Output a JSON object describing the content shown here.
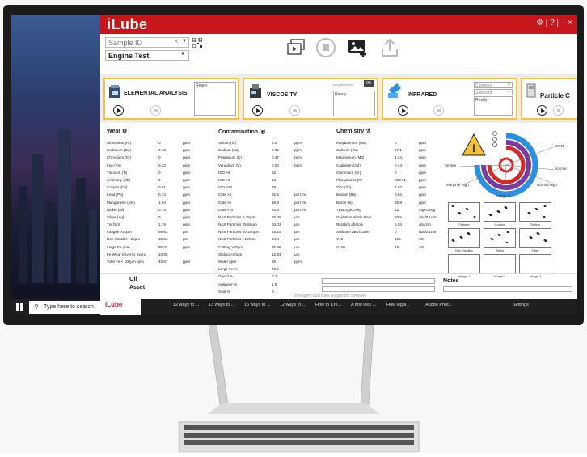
{
  "app": {
    "logo": "iLube",
    "footer": "Intelligent Lubricant Diagnostic Software"
  },
  "window_controls": {
    "help": "?",
    "minimize": "–",
    "close": "×"
  },
  "toolbar": {
    "sample_id_placeholder": "Sample ID",
    "sample_clear": "×",
    "engine_test": "Engine Test"
  },
  "modules": {
    "elemental": {
      "title": "ELEMENTAL ANALYSIS",
      "status": "Ready"
    },
    "viscosity": {
      "title": "VISCOSITY",
      "status": "Ready",
      "counter_label": "sample count",
      "counter": "00"
    },
    "infrared": {
      "title": "INFRARED",
      "select1": "Category",
      "select2": "Standard",
      "status": "Ready"
    },
    "particle": {
      "title": "Particle C"
    }
  },
  "wear": {
    "title": "Wear",
    "rows": [
      [
        "Aluminium (Al)",
        "0",
        "ppm"
      ],
      [
        "Cadmium (Cd)",
        "0.43",
        "ppm"
      ],
      [
        "Chromium (Cr)",
        "0",
        "ppm"
      ],
      [
        "Iron (Fe)",
        "0.22",
        "ppm"
      ],
      [
        "Titanium (Ti)",
        "0",
        "ppm"
      ],
      [
        "Antimony (Sb)",
        "0",
        "ppm"
      ],
      [
        "Copper (Cu)",
        "0.01",
        "ppm"
      ],
      [
        "Lead (Pb)",
        "0.74",
        "ppm"
      ],
      [
        "Manganese (Mn)",
        "1.84",
        "ppm"
      ],
      [
        "Nickel (Ni)",
        "0.75",
        "ppm"
      ],
      [
        "Silver (Ag)",
        "0",
        "ppm"
      ],
      [
        "Tin (Sn)",
        "1.79",
        "ppm"
      ],
      [
        "Fatigue >20μm",
        "56.63",
        "μm"
      ],
      [
        "Non-Metallic >20μm",
        "12.53",
        "μm"
      ],
      [
        "Large Fe ppm",
        "95.42",
        "ppm"
      ],
      [
        "Fe Wear Severity Index",
        "10.56",
        ""
      ],
      [
        "Total Fe < 100μm ppm",
        "40.67",
        "ppm"
      ]
    ]
  },
  "contamination": {
    "title": "Contamination",
    "rows": [
      [
        "Silicon (Si)",
        "5.5",
        "ppm"
      ],
      [
        "Sodium (Na)",
        "6.62",
        "ppm"
      ],
      [
        "Potassium (K)",
        "0.47",
        "ppm"
      ],
      [
        "Vanadium (V)",
        "0.06",
        "ppm"
      ],
      [
        "ISO >4",
        "52",
        ""
      ],
      [
        "ISO >6",
        "13",
        ""
      ],
      [
        "ISO >14",
        "79",
        ""
      ],
      [
        "Cnts >4",
        "32.5",
        "part./ml"
      ],
      [
        "Cnts >6",
        "36.9",
        "part./ml"
      ],
      [
        "Cnts >14",
        "93.6",
        "part./ml"
      ],
      [
        "NAS Particles 5-15μm",
        "65.05",
        "μm"
      ],
      [
        "NAS Particles 25-50μm",
        "93.03",
        "μm"
      ],
      [
        "NAS Particles 50-100μm",
        "48.15",
        "μm"
      ],
      [
        "NAS Particles >100μm",
        "34.4",
        "μm"
      ],
      [
        "Cutting >20μm",
        "35.98",
        "μm"
      ],
      [
        "Sliding >20μm",
        "12.93",
        "μm"
      ],
      [
        "Water ppm",
        "68",
        "ppm"
      ],
      [
        "Large Fe %",
        "70.6",
        ""
      ],
      [
        "Glycol %",
        "0.3",
        ""
      ],
      [
        "Antiwear %",
        "1.6",
        ""
      ],
      [
        "Soot %",
        "0",
        ""
      ]
    ]
  },
  "chemistry": {
    "title": "Chemistry",
    "rows": [
      [
        "Molybdenum (Mo)",
        "0",
        "ppm"
      ],
      [
        "Calcium (Ca)",
        "27.1",
        "ppm"
      ],
      [
        "Magnesium (Mg)",
        "1.34",
        "ppm"
      ],
      [
        "Cadmium (Cd)",
        "0.43",
        "ppm"
      ],
      [
        "Chromium (Cr)",
        "0",
        "ppm"
      ],
      [
        "Phosphorus (P)",
        "263.61",
        "ppm"
      ],
      [
        "Zinc (Zn)",
        "4.07",
        "ppm"
      ],
      [
        "Barium (Ba)",
        "0.04",
        "ppm"
      ],
      [
        "Boron (B)",
        "25.9",
        "ppm"
      ],
      [
        "TBN mgKOH/g",
        "12",
        "mgKOH/g"
      ],
      [
        "Oxidation abs/0.1mm",
        "20.5",
        "abs/0.1mm"
      ],
      [
        "Nitration abs/cm",
        "5.03",
        "abs/cm"
      ],
      [
        "Sulfation abs/0.1mm",
        "0",
        "abs/0.1mm"
      ],
      [
        "V40",
        "195",
        "cSt"
      ],
      [
        "V100",
        "18",
        "cSt"
      ]
    ]
  },
  "gauge": {
    "labels": {
      "wcm": "WCM",
      "normal": "Normal",
      "severe": "Severe",
      "marginal_high": "Marginal High",
      "normal_high": "Normal High",
      "marginal": "Marginal"
    }
  },
  "thumbnails": [
    "Fatigue",
    "Cutting",
    "Sliding",
    "Non Metallic",
    "Water",
    "Fiber",
    "Image 1",
    "Image 2",
    "Image 3"
  ],
  "bottom": {
    "oil": "Oil",
    "asset": "Asset",
    "notes": "Notes"
  },
  "taskbar": {
    "search": "Type here to search",
    "items": [
      "12 ways to ...",
      "13 ways to ...",
      "16 ways to ...",
      "12 ways to ...",
      "How to Cre...",
      "A first look ...",
      "How legal...",
      "Adobe Phot...",
      "Settings"
    ]
  },
  "colors": {
    "brand_red": "#c8161d",
    "module_border": "#f3c13a",
    "gauge_blue": "#2a90e0",
    "gauge_purple": "#7a3aa0",
    "gauge_red": "#d62828"
  }
}
